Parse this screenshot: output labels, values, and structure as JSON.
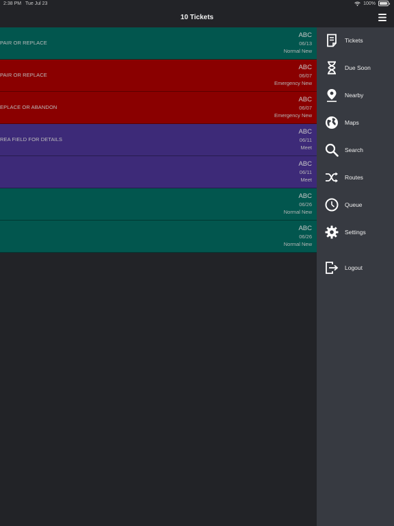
{
  "status_bar": {
    "time": "2:38 PM",
    "date": "Tue Jul 23",
    "battery": "100%"
  },
  "header": {
    "title": "10 Tickets"
  },
  "tickets": [
    {
      "description": "PAIR OR REPLACE",
      "code": "ABC",
      "date": "06/13",
      "priority": "Normal New",
      "color": "#02564e"
    },
    {
      "description": "PAIR OR REPLACE",
      "code": "ABC",
      "date": "06/07",
      "priority": "Emergency New",
      "color": "#8a0000"
    },
    {
      "description": "EPLACE OR ABANDON",
      "code": "ABC",
      "date": "06/07",
      "priority": "Emergency New",
      "color": "#8a0000"
    },
    {
      "description": "REA FIELD FOR DETAILS",
      "code": "ABC",
      "date": "06/11",
      "priority": "Meet",
      "color": "#3d2a78"
    },
    {
      "description": "",
      "code": "ABC",
      "date": "06/11",
      "priority": "Meet",
      "color": "#3d2a78"
    },
    {
      "description": "",
      "code": "ABC",
      "date": "06/26",
      "priority": "Normal New",
      "color": "#02564e"
    },
    {
      "description": "",
      "code": "ABC",
      "date": "06/26",
      "priority": "Normal New",
      "color": "#02564e"
    }
  ],
  "sidebar": {
    "items": [
      {
        "label": "Tickets",
        "icon": "ticket-icon"
      },
      {
        "label": "Due Soon",
        "icon": "hourglass-icon"
      },
      {
        "label": "Nearby",
        "icon": "location-pin-icon"
      },
      {
        "label": "Maps",
        "icon": "globe-icon"
      },
      {
        "label": "Search",
        "icon": "search-icon"
      },
      {
        "label": "Routes",
        "icon": "shuffle-icon"
      },
      {
        "label": "Queue",
        "icon": "clock-icon"
      },
      {
        "label": "Settings",
        "icon": "gear-icon"
      },
      {
        "label": "Logout",
        "icon": "logout-icon"
      }
    ]
  }
}
